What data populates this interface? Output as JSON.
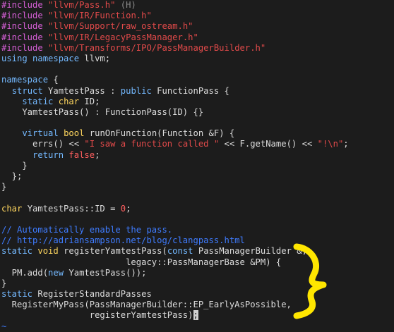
{
  "editor": {
    "lines": [
      [
        {
          "t": "#include ",
          "c": "preproc"
        },
        {
          "t": "\"llvm/Pass.h\"",
          "c": "string"
        },
        {
          "t": " (H)",
          "c": "shadow"
        }
      ],
      [
        {
          "t": "#include ",
          "c": "preproc"
        },
        {
          "t": "\"llvm/IR/Function.h\"",
          "c": "string"
        }
      ],
      [
        {
          "t": "#include ",
          "c": "preproc"
        },
        {
          "t": "\"llvm/Support/raw_ostream.h\"",
          "c": "string"
        }
      ],
      [
        {
          "t": "#include ",
          "c": "preproc"
        },
        {
          "t": "\"llvm/IR/LegacyPassManager.h\"",
          "c": "string"
        }
      ],
      [
        {
          "t": "#include ",
          "c": "preproc"
        },
        {
          "t": "\"llvm/Transforms/IPO/PassManagerBuilder.h\"",
          "c": "string"
        }
      ],
      [
        {
          "t": "using",
          "c": "keyword"
        },
        {
          "t": " ",
          "c": "plain"
        },
        {
          "t": "namespace",
          "c": "keyword"
        },
        {
          "t": " llvm;",
          "c": "plain"
        }
      ],
      [
        {
          "t": "",
          "c": "plain"
        }
      ],
      [
        {
          "t": "namespace",
          "c": "keyword"
        },
        {
          "t": " {",
          "c": "plain"
        }
      ],
      [
        {
          "t": "  ",
          "c": "plain"
        },
        {
          "t": "struct",
          "c": "keyword"
        },
        {
          "t": " YamtestPass : ",
          "c": "plain"
        },
        {
          "t": "public",
          "c": "keyword"
        },
        {
          "t": " FunctionPass {",
          "c": "plain"
        }
      ],
      [
        {
          "t": "    ",
          "c": "plain"
        },
        {
          "t": "static",
          "c": "keyword"
        },
        {
          "t": " ",
          "c": "plain"
        },
        {
          "t": "char",
          "c": "type"
        },
        {
          "t": " ID;",
          "c": "plain"
        }
      ],
      [
        {
          "t": "    YamtestPass() : FunctionPass(ID) {}",
          "c": "plain"
        }
      ],
      [
        {
          "t": "",
          "c": "plain"
        }
      ],
      [
        {
          "t": "    ",
          "c": "plain"
        },
        {
          "t": "virtual",
          "c": "keyword"
        },
        {
          "t": " ",
          "c": "plain"
        },
        {
          "t": "bool",
          "c": "type"
        },
        {
          "t": " runOnFunction(Function &F) {",
          "c": "plain"
        }
      ],
      [
        {
          "t": "      errs() << ",
          "c": "plain"
        },
        {
          "t": "\"I saw a function called \"",
          "c": "string"
        },
        {
          "t": " << F.getName() << ",
          "c": "plain"
        },
        {
          "t": "\"!\\n\"",
          "c": "string"
        },
        {
          "t": ";",
          "c": "plain"
        }
      ],
      [
        {
          "t": "      ",
          "c": "plain"
        },
        {
          "t": "return",
          "c": "keyword"
        },
        {
          "t": " ",
          "c": "plain"
        },
        {
          "t": "false",
          "c": "number"
        },
        {
          "t": ";",
          "c": "plain"
        }
      ],
      [
        {
          "t": "    }",
          "c": "plain"
        }
      ],
      [
        {
          "t": "  };",
          "c": "plain"
        }
      ],
      [
        {
          "t": "}",
          "c": "plain"
        }
      ],
      [
        {
          "t": "",
          "c": "plain"
        }
      ],
      [
        {
          "t": "char",
          "c": "type"
        },
        {
          "t": " YamtestPass::ID = ",
          "c": "plain"
        },
        {
          "t": "0",
          "c": "number"
        },
        {
          "t": ";",
          "c": "plain"
        }
      ],
      [
        {
          "t": "",
          "c": "plain"
        }
      ],
      [
        {
          "t": "// Automatically enable the pass.",
          "c": "comment"
        }
      ],
      [
        {
          "t": "// http://adriansampson.net/blog/clangpass.html",
          "c": "comment"
        }
      ],
      [
        {
          "t": "static",
          "c": "keyword"
        },
        {
          "t": " ",
          "c": "plain"
        },
        {
          "t": "void",
          "c": "type"
        },
        {
          "t": " registerYamtestPass(",
          "c": "plain"
        },
        {
          "t": "const",
          "c": "keyword"
        },
        {
          "t": " PassManagerBuilder &,",
          "c": "plain"
        }
      ],
      [
        {
          "t": "                        legacy::PassManagerBase &PM) {",
          "c": "plain"
        }
      ],
      [
        {
          "t": "  PM.add(",
          "c": "plain"
        },
        {
          "t": "new",
          "c": "keyword"
        },
        {
          "t": " YamtestPass());",
          "c": "plain"
        }
      ],
      [
        {
          "t": "}",
          "c": "plain"
        }
      ],
      [
        {
          "t": "static",
          "c": "keyword"
        },
        {
          "t": " RegisterStandardPasses",
          "c": "plain"
        }
      ],
      [
        {
          "t": "  RegisterMyPass(PassManagerBuilder::EP_EarlyAsPossible,",
          "c": "plain"
        }
      ],
      [
        {
          "t": "                 registerYamtestPass)",
          "c": "plain"
        },
        {
          "t": ";",
          "c": "cursor"
        }
      ],
      [
        {
          "t": "~",
          "c": "tilde"
        }
      ]
    ]
  },
  "annotation": {
    "color": "#ffe600",
    "kind": "hand-drawn-bracket"
  }
}
